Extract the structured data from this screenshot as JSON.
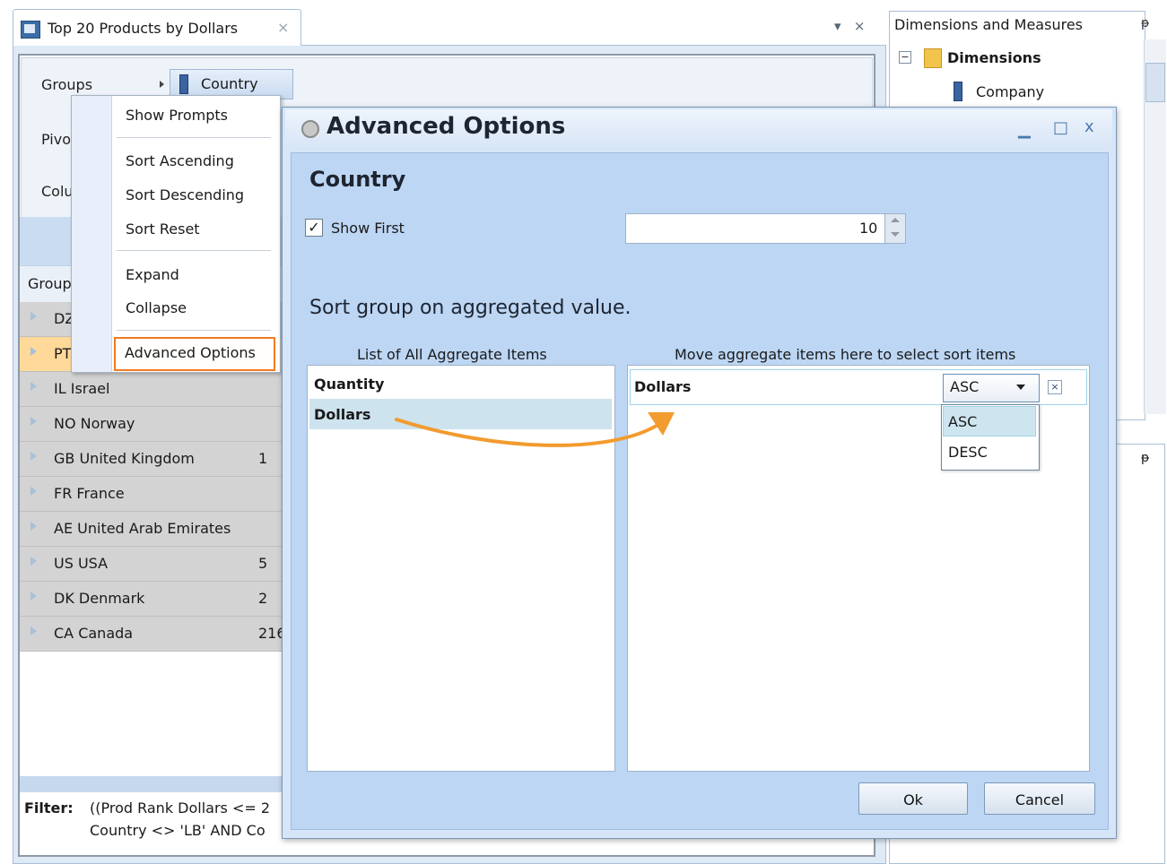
{
  "document_tab": {
    "title": "Top 20 Products by Dollars",
    "close": "×"
  },
  "tab_controls": {
    "dropdown": "▾",
    "close": "×"
  },
  "groups_panel": {
    "groups_label": "Groups",
    "pivot_label": "Pivo",
    "columns_label": "Colu",
    "country_chip": "Country",
    "grid_header": "Group"
  },
  "grid_rows": [
    {
      "name": "DZ",
      "value": ""
    },
    {
      "name": "PT",
      "value": ""
    },
    {
      "name": "IL Israel",
      "value": ""
    },
    {
      "name": "NO Norway",
      "value": ""
    },
    {
      "name": "GB United Kingdom",
      "value": "1"
    },
    {
      "name": "FR France",
      "value": ""
    },
    {
      "name": "AE United Arab Emirates",
      "value": ""
    },
    {
      "name": "US USA",
      "value": "5"
    },
    {
      "name": "DK Denmark",
      "value": "2"
    },
    {
      "name": "CA Canada",
      "value": "216"
    }
  ],
  "filter": {
    "label": "Filter:",
    "line1": "((Prod Rank Dollars <= 2",
    "line2": "Country <> 'LB'  AND Co"
  },
  "context_menu": {
    "show_prompts": "Show Prompts",
    "sort_ascending": "Sort Ascending",
    "sort_descending": "Sort Descending",
    "sort_reset": "Sort Reset",
    "expand": "Expand",
    "collapse": "Collapse",
    "advanced_options": "Advanced Options"
  },
  "dock": {
    "title": "Dimensions and Measures",
    "pin": "ᵽ",
    "tree_dimensions": "Dimensions",
    "tree_company": "Company",
    "tree_minus": "−"
  },
  "dialog": {
    "title": "Advanced Options",
    "min": "▁",
    "max": "□",
    "close": "x",
    "heading": "Country",
    "show_first_label": "Show First",
    "show_first_checked": "✓",
    "show_first_value": "10",
    "sort_note": "Sort group on aggregated value.",
    "left_list_header": "List of All Aggregate Items",
    "right_list_header": "Move aggregate items here to select sort items",
    "left_items": [
      "Quantity",
      "Dollars"
    ],
    "right_items": [
      "Dollars"
    ],
    "sort_selected": "ASC",
    "sort_options": [
      "ASC",
      "DESC"
    ],
    "remove_icon": "×",
    "ok": "Ok",
    "cancel": "Cancel"
  },
  "colors": {
    "accent_orange": "#f07b22",
    "dialog_bg": "#bcd6f4",
    "selected_row": "#ffd99a"
  }
}
